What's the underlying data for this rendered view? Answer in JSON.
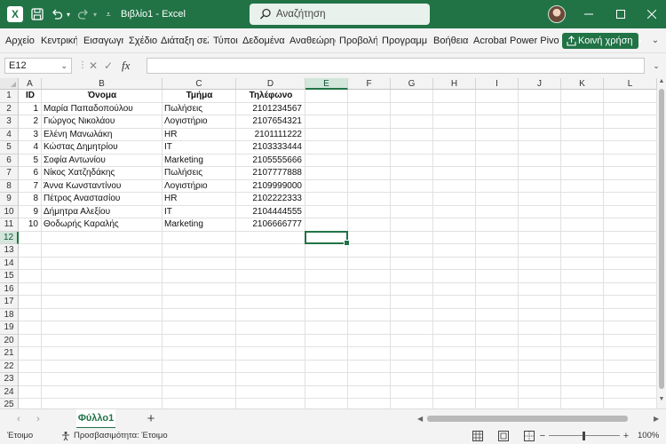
{
  "titlebar": {
    "app_icon": "excel-logo",
    "app_letter": "X",
    "title": "Βιβλίο1  -  Excel",
    "search_placeholder": "Αναζήτηση",
    "save_icon": "save-icon",
    "undo_icon": "undo-icon",
    "redo_icon": "redo-icon",
    "customize_icon": "chevron-down-icon",
    "minimize_icon": "minimize-icon",
    "maximize_icon": "maximize-icon",
    "close_icon": "close-icon"
  },
  "ribbon": {
    "tabs": [
      "Αρχείο",
      "Κεντρική",
      "Εισαγωγή",
      "Σχέδιο",
      "Διάταξη σελ",
      "Τύποι",
      "Δεδομένα",
      "Αναθεώρησ",
      "Προβολή",
      "Προγραμμ",
      "Βοήθεια",
      "Acrobat",
      "Power Pivot"
    ],
    "share_label": "Κοινή χρήση",
    "collapse_icon": "chevron-down-icon"
  },
  "formula_bar": {
    "name_box": "E12",
    "cancel_icon": "✕",
    "enter_icon": "✓",
    "fx_label": "fx",
    "formula": ""
  },
  "sheet": {
    "columns": [
      "A",
      "B",
      "C",
      "D",
      "E",
      "F",
      "G",
      "H",
      "I",
      "J",
      "K",
      "L"
    ],
    "selected_column": "E",
    "rows": [
      "1",
      "2",
      "3",
      "4",
      "5",
      "6",
      "7",
      "8",
      "9",
      "10",
      "11",
      "12",
      "13",
      "14",
      "15",
      "16",
      "17",
      "18",
      "19",
      "20",
      "21",
      "22",
      "23",
      "24",
      "25"
    ],
    "selected_row": "12",
    "headers": [
      "ID",
      "Όνομα",
      "Τμήμα",
      "Τηλέφωνο"
    ],
    "data": [
      [
        "1",
        "Μαρία Παπαδοπούλου",
        "Πωλήσεις",
        "2101234567"
      ],
      [
        "2",
        "Γιώργος Νικολάου",
        "Λογιστήριο",
        "2107654321"
      ],
      [
        "3",
        "Ελένη Μανωλάκη",
        "HR",
        "2101111222"
      ],
      [
        "4",
        "Κώστας Δημητρίου",
        "IT",
        "2103333444"
      ],
      [
        "5",
        "Σοφία Αντωνίου",
        "Marketing",
        "2105555666"
      ],
      [
        "6",
        "Νίκος Χατζηδάκης",
        "Πωλήσεις",
        "2107777888"
      ],
      [
        "7",
        "Άννα Κωνσταντίνου",
        "Λογιστήριο",
        "2109999000"
      ],
      [
        "8",
        "Πέτρος Αναστασίου",
        "HR",
        "2102222333"
      ],
      [
        "9",
        "Δήμητρα Αλεξίου",
        "IT",
        "2104444555"
      ],
      [
        "10",
        "Θοδωρής Καραλής",
        "Marketing",
        "2106666777"
      ]
    ],
    "active_cell": "E12"
  },
  "sheet_tabs": {
    "tabs": [
      "Φύλλο1"
    ],
    "add_label": "+",
    "prev_icon": "‹",
    "next_icon": "›"
  },
  "status_bar": {
    "mode": "Έτοιμο",
    "accessibility": "Προσβασιμότητα: Έτοιμο",
    "zoom": "100%",
    "zoom_minus": "−",
    "zoom_plus": "+"
  },
  "colors": {
    "accent": "#217346"
  }
}
